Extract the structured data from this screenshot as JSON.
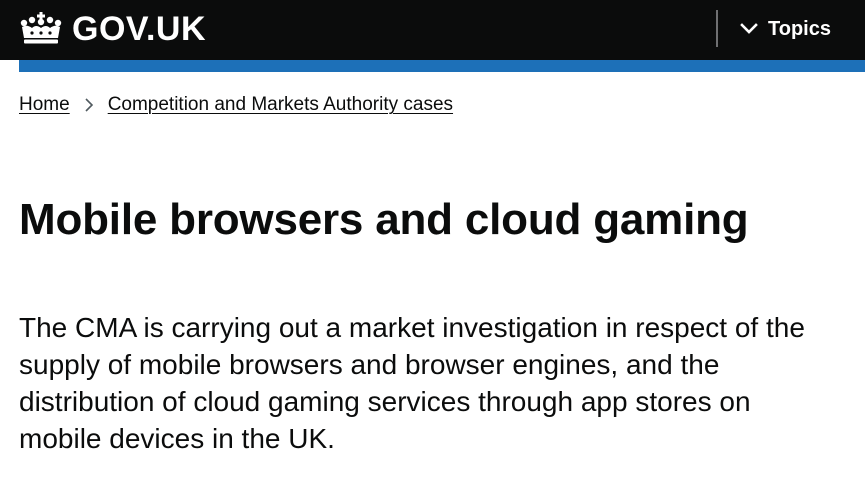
{
  "header": {
    "logo_text": "GOV.UK",
    "topics_label": "Topics",
    "background": "#0b0c0c",
    "accent_bar_color": "#1d70b8"
  },
  "breadcrumb": {
    "items": [
      {
        "label": "Home"
      },
      {
        "label": "Competition and Markets Authority cases"
      }
    ]
  },
  "page": {
    "title": "Mobile browsers and cloud gaming",
    "lede": "The CMA is carrying out a market investigation in respect of the supply of mobile browsers and browser engines, and the distribution of cloud gaming services through app stores on mobile devices in the UK."
  }
}
